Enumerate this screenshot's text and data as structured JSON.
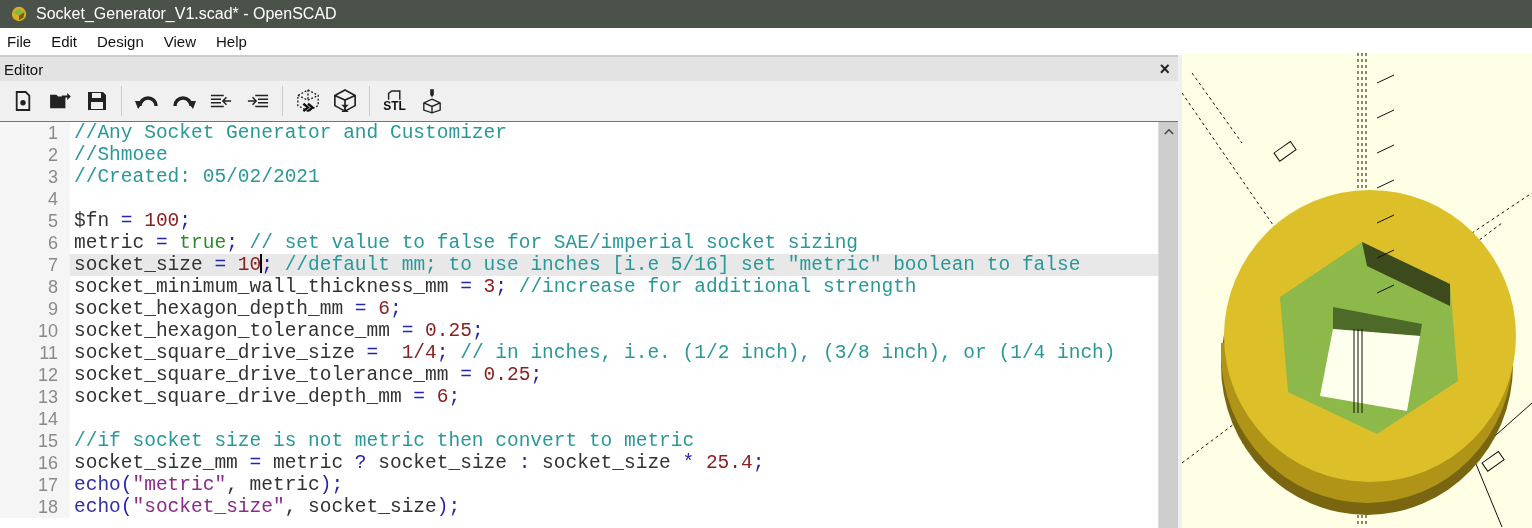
{
  "window": {
    "title": "Socket_Generator_V1.scad* - OpenSCAD"
  },
  "menu": [
    {
      "label": "File"
    },
    {
      "label": "Edit"
    },
    {
      "label": "Design"
    },
    {
      "label": "View"
    },
    {
      "label": "Help"
    }
  ],
  "editor": {
    "title": "Editor",
    "close": "×",
    "toolbar": [
      [
        {
          "kind": "new"
        },
        {
          "kind": "open"
        },
        {
          "kind": "save"
        }
      ],
      [
        {
          "kind": "undo"
        },
        {
          "kind": "redo"
        },
        {
          "kind": "unindent"
        },
        {
          "kind": "indent"
        }
      ],
      [
        {
          "kind": "preview"
        },
        {
          "kind": "render"
        }
      ],
      [
        {
          "kind": "export",
          "label": "STL"
        },
        {
          "kind": "send"
        }
      ]
    ],
    "lines": [
      {
        "number": "1",
        "current": false,
        "tokens": [
          {
            "kind": "comment",
            "text": "//Any Socket Generator and Customizer"
          }
        ]
      },
      {
        "number": "2",
        "current": false,
        "tokens": [
          {
            "kind": "comment",
            "text": "//Shmoee"
          }
        ]
      },
      {
        "number": "3",
        "current": false,
        "tokens": [
          {
            "kind": "comment",
            "text": "//Created: 05/02/2021"
          }
        ]
      },
      {
        "number": "4",
        "current": false
      },
      {
        "number": "5",
        "current": false,
        "tokens": [
          {
            "kind": "plain",
            "text": "$fn "
          },
          {
            "kind": "op",
            "text": "="
          },
          {
            "kind": "number",
            "text": " 100"
          },
          {
            "kind": "op",
            "text": ";"
          }
        ]
      },
      {
        "number": "6",
        "current": false,
        "tokens": [
          {
            "kind": "plain",
            "text": "metric "
          },
          {
            "kind": "op",
            "text": "="
          },
          {
            "kind": "bool",
            "text": " true"
          },
          {
            "kind": "op",
            "text": ";"
          },
          {
            "kind": "comment",
            "text": " // set value to false for SAE/imperial socket sizing"
          }
        ]
      },
      {
        "number": "7",
        "current": true,
        "tokens": [
          {
            "kind": "plain",
            "text": "socket_size "
          },
          {
            "kind": "op",
            "text": "="
          },
          {
            "kind": "number",
            "text": " 10"
          },
          {
            "kind": "caret"
          },
          {
            "kind": "op",
            "text": ";"
          },
          {
            "kind": "comment",
            "text": " //default mm; to use inches [i.e 5/16] set \"metric\" boolean to false"
          }
        ]
      },
      {
        "number": "8",
        "current": false,
        "tokens": [
          {
            "kind": "plain",
            "text": "socket_minimum_wall_thickness_mm "
          },
          {
            "kind": "op",
            "text": "="
          },
          {
            "kind": "number",
            "text": " 3"
          },
          {
            "kind": "op",
            "text": ";"
          },
          {
            "kind": "comment",
            "text": " //increase for additional strength"
          }
        ]
      },
      {
        "number": "9",
        "current": false,
        "tokens": [
          {
            "kind": "plain",
            "text": "socket_hexagon_depth_mm "
          },
          {
            "kind": "op",
            "text": "="
          },
          {
            "kind": "number",
            "text": " 6"
          },
          {
            "kind": "op",
            "text": ";"
          }
        ]
      },
      {
        "number": "10",
        "current": false,
        "tokens": [
          {
            "kind": "plain",
            "text": "socket_hexagon_tolerance_mm "
          },
          {
            "kind": "op",
            "text": "="
          },
          {
            "kind": "number",
            "text": " 0.25"
          },
          {
            "kind": "op",
            "text": ";"
          }
        ]
      },
      {
        "number": "11",
        "current": false,
        "tokens": [
          {
            "kind": "plain",
            "text": "socket_square_drive_size "
          },
          {
            "kind": "op",
            "text": "="
          },
          {
            "kind": "number",
            "text": "  1/4"
          },
          {
            "kind": "op",
            "text": ";"
          },
          {
            "kind": "comment",
            "text": " // in inches, i.e. (1/2 inch), (3/8 inch), or (1/4 inch)"
          }
        ]
      },
      {
        "number": "12",
        "current": false,
        "tokens": [
          {
            "kind": "plain",
            "text": "socket_square_drive_tolerance_mm "
          },
          {
            "kind": "op",
            "text": "="
          },
          {
            "kind": "number",
            "text": " 0.25"
          },
          {
            "kind": "op",
            "text": ";"
          }
        ]
      },
      {
        "number": "13",
        "current": false,
        "tokens": [
          {
            "kind": "plain",
            "text": "socket_square_drive_depth_mm "
          },
          {
            "kind": "op",
            "text": "="
          },
          {
            "kind": "number",
            "text": " 6"
          },
          {
            "kind": "op",
            "text": ";"
          }
        ]
      },
      {
        "number": "14",
        "current": false
      },
      {
        "number": "15",
        "current": false,
        "tokens": [
          {
            "kind": "comment",
            "text": "//if socket size is not metric then convert to metric"
          }
        ]
      },
      {
        "number": "16",
        "current": false,
        "tokens": [
          {
            "kind": "plain",
            "text": "socket_size_mm "
          },
          {
            "kind": "op",
            "text": "="
          },
          {
            "kind": "plain",
            "text": " metric "
          },
          {
            "kind": "op",
            "text": "?"
          },
          {
            "kind": "plain",
            "text": " socket_size "
          },
          {
            "kind": "op",
            "text": ":"
          },
          {
            "kind": "plain",
            "text": " socket_size "
          },
          {
            "kind": "op",
            "text": "*"
          },
          {
            "kind": "number",
            "text": " 25.4"
          },
          {
            "kind": "op",
            "text": ";"
          }
        ]
      },
      {
        "number": "17",
        "current": false,
        "tokens": [
          {
            "kind": "func",
            "text": "echo"
          },
          {
            "kind": "op",
            "text": "("
          },
          {
            "kind": "string",
            "text": "\"metric\""
          },
          {
            "kind": "plain",
            "text": ", metric"
          },
          {
            "kind": "op",
            "text": ");"
          }
        ]
      },
      {
        "number": "18",
        "current": false,
        "tokens": [
          {
            "kind": "func",
            "text": "echo"
          },
          {
            "kind": "op",
            "text": "("
          },
          {
            "kind": "string",
            "text": "\"socket_size\""
          },
          {
            "kind": "plain",
            "text": ", socket_size"
          },
          {
            "kind": "op",
            "text": ");"
          }
        ]
      }
    ]
  }
}
